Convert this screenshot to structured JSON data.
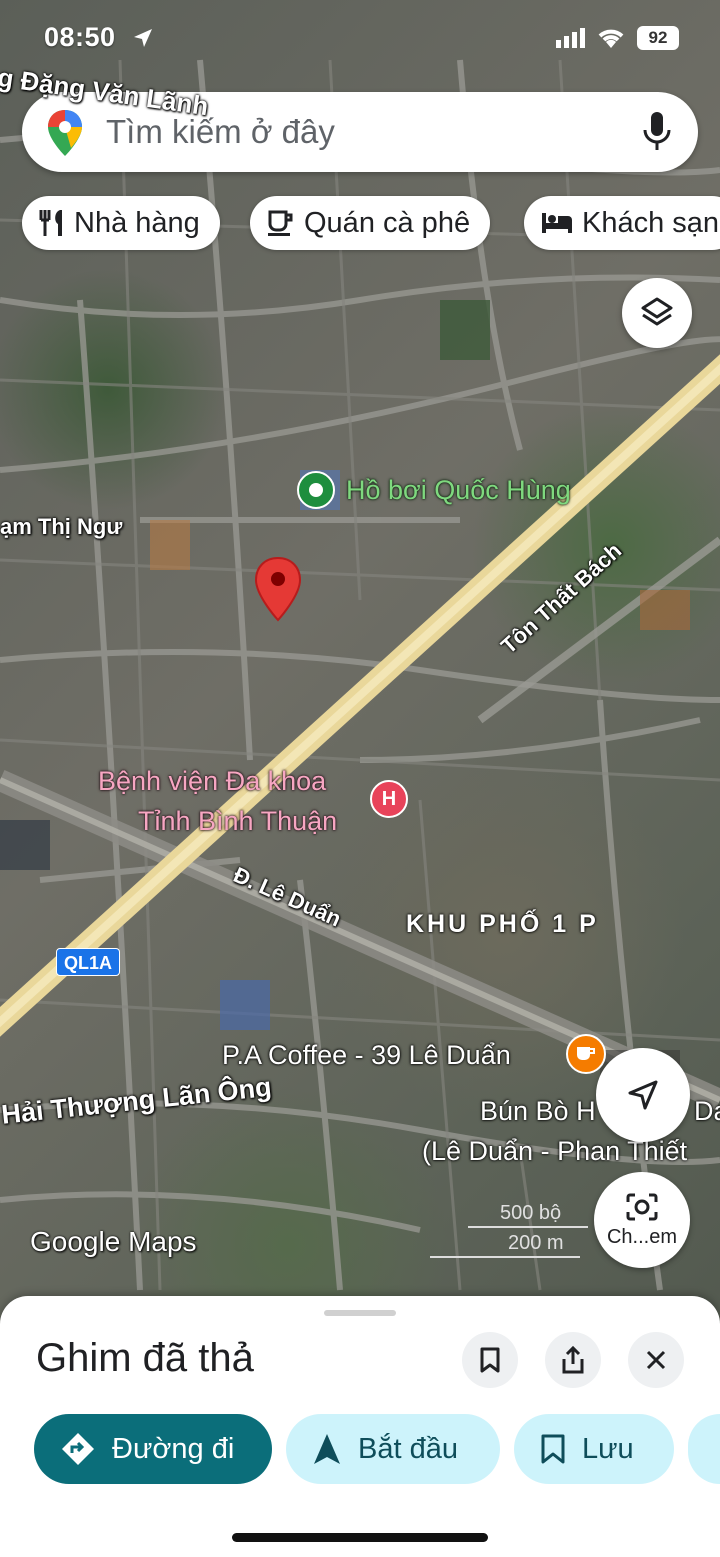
{
  "status_bar": {
    "time": "08:50",
    "battery": "92"
  },
  "search": {
    "placeholder": "Tìm kiếm ở đây"
  },
  "chips": [
    {
      "label": "Nhà hàng",
      "icon": "restaurant-icon"
    },
    {
      "label": "Quán cà phê",
      "icon": "coffee-icon"
    },
    {
      "label": "Khách sạn",
      "icon": "hotel-icon"
    }
  ],
  "map": {
    "street_labels": {
      "top_left": "g Đặng Văn Lãnh",
      "left": "ạm Thị Ngư",
      "ton_that_bach": "Tôn Thất Bách",
      "le_duan": "Đ. Lê Duẩn",
      "hai_thuong": "Hải Thượng Lãn Ông"
    },
    "places": {
      "pool": "Hồ bơi Quốc Hùng",
      "hospital_line1": "Bệnh viện Đa khoa",
      "hospital_line2": "Tỉnh Bình Thuận",
      "coffee": "P.A Coffee - 39 Lê Duẩn",
      "bun_line1": "Bún Bò H",
      "bun_line1_end": "Da",
      "bun_line2": "(Lê Duẩn - Phan Thiết"
    },
    "district": "KHU PHỐ 1 P",
    "highway_shield": "QL1A",
    "hospital_marker": "H",
    "attribution": "Google Maps",
    "scale_ft": "500 bộ",
    "scale_m": "200 m",
    "camera_label": "Ch...em",
    "road_color": "#e9d79a",
    "pin_color": "#e53935"
  },
  "sheet": {
    "title": "Ghim đã thả",
    "actions": [
      {
        "label": "Đường đi",
        "icon": "directions-icon"
      },
      {
        "label": "Bắt đầu",
        "icon": "navigation-arrow-icon"
      },
      {
        "label": "Lưu",
        "icon": "bookmark-icon"
      }
    ]
  }
}
